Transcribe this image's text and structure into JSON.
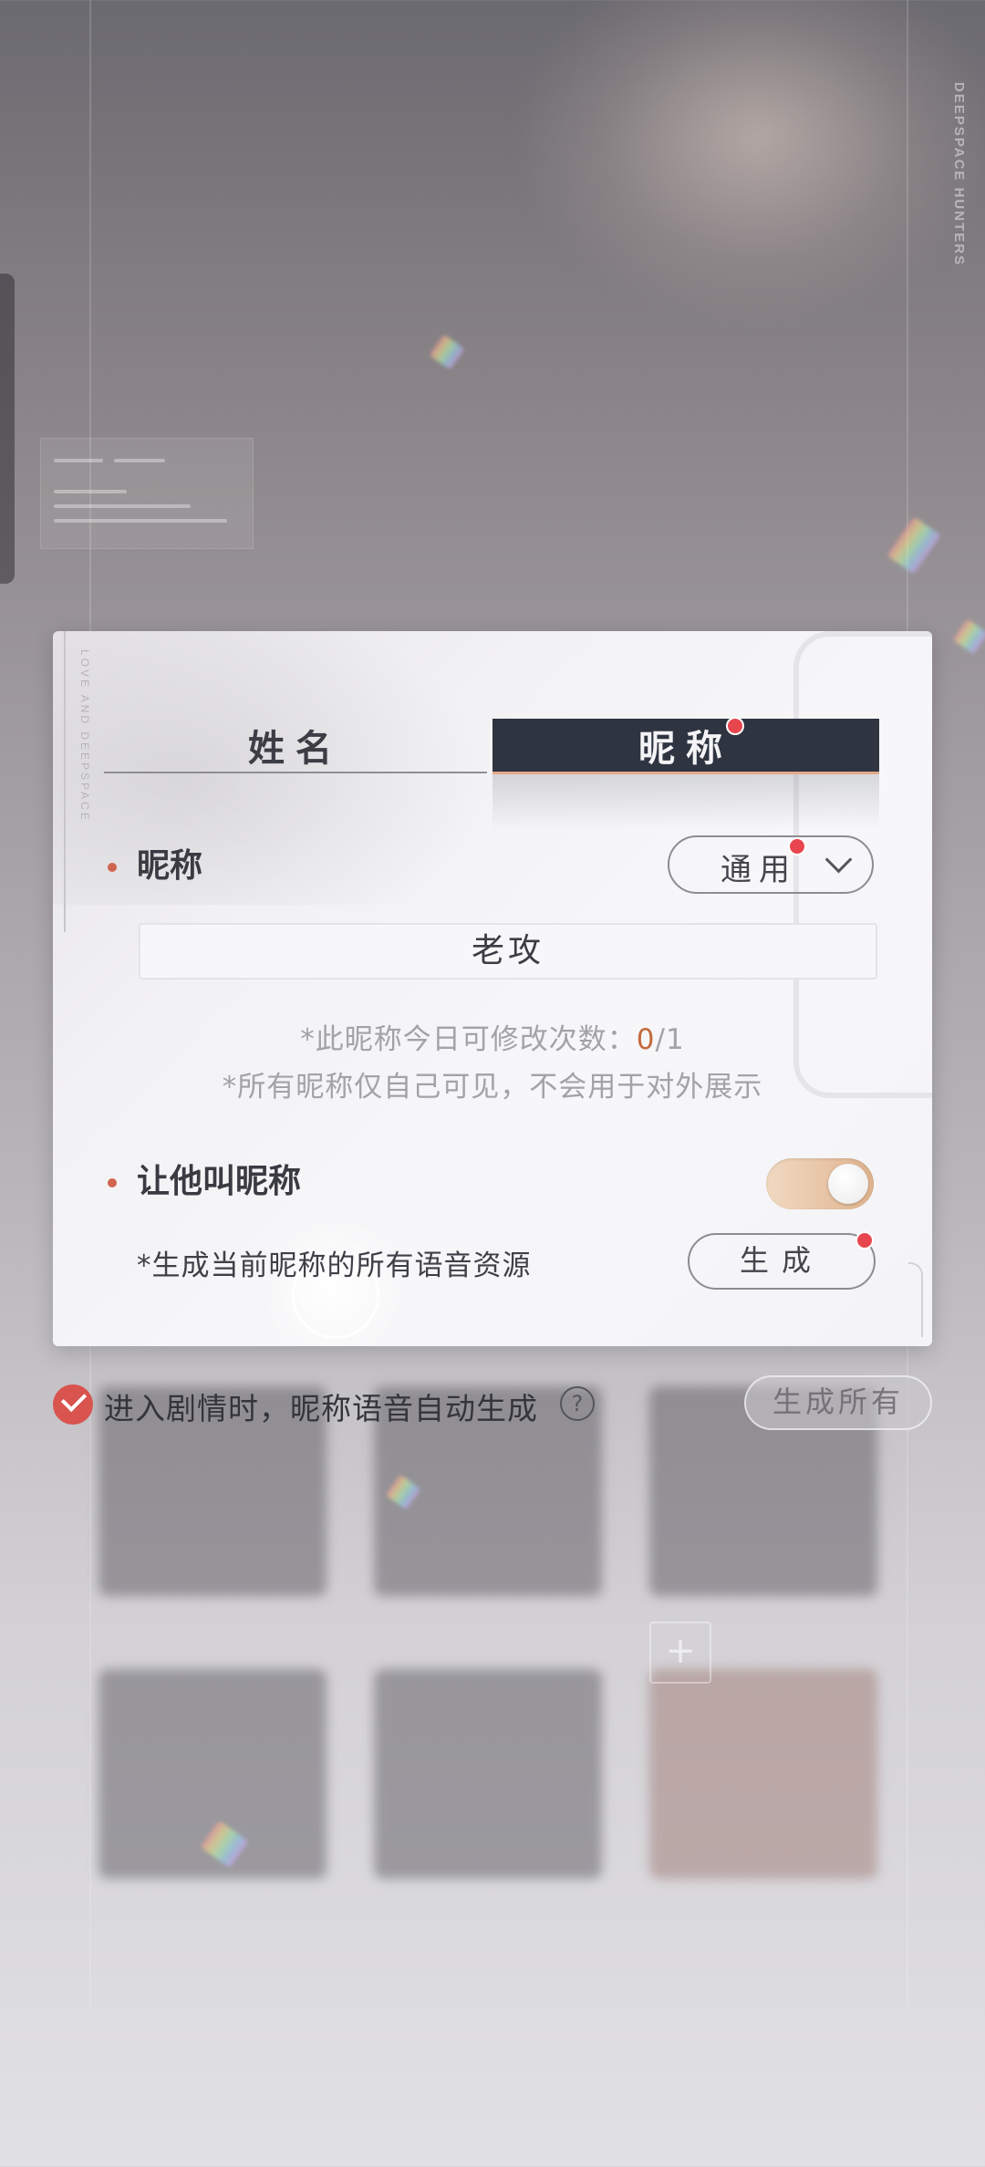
{
  "background": {
    "brand_vertical": "DEEPSPACE HUNTERS",
    "add_icon": "plus-icon"
  },
  "dialog": {
    "brand_vertical": "LOVE AND DEEPSPACE",
    "tabs": [
      {
        "label": "姓名",
        "active": false
      },
      {
        "label": "昵称",
        "active": true,
        "badge": "red-dot"
      }
    ],
    "nickname_section": {
      "label": "昵称",
      "dropdown_value": "通用",
      "dropdown_icon": "chevron-down-icon",
      "input_value": "老攻",
      "hint_prefix": "*此昵称今日可修改次数：",
      "hint_used": "0",
      "hint_total": "/1",
      "hint_private": "*所有昵称仅自己可见，不会用于对外展示"
    },
    "call_section": {
      "label": "让他叫昵称",
      "toggle_on": true,
      "generate_hint": "*生成当前昵称的所有语音资源",
      "generate_label": "生成"
    }
  },
  "footer": {
    "auto_generate_checked": true,
    "auto_generate_label": "进入剧情时，昵称语音自动生成",
    "help_icon": "?",
    "generate_all_label": "生成所有"
  },
  "colors": {
    "accent_dark": "#2e3440",
    "accent_peach": "#e3a989",
    "badge_red": "#e8464f",
    "highlight_orange": "#c56a3c"
  }
}
